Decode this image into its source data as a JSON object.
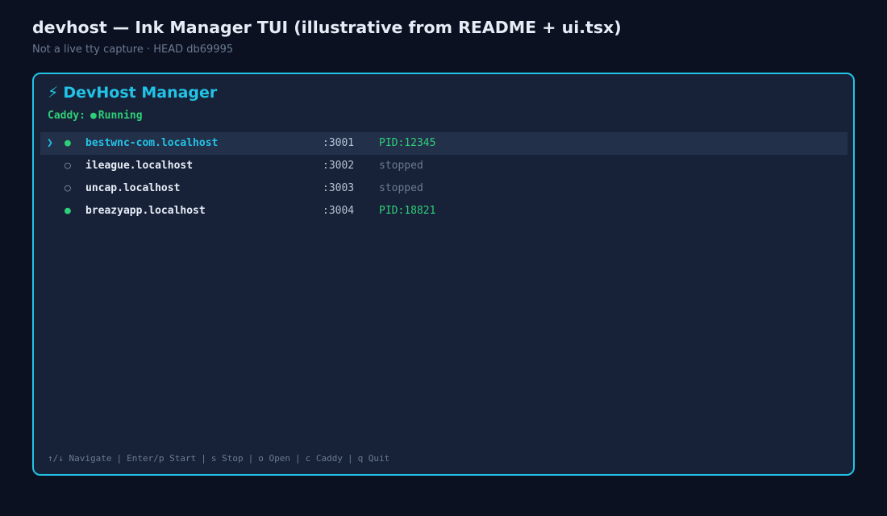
{
  "page": {
    "title": "devhost — Ink Manager TUI (illustrative from README + ui.tsx)",
    "subtitle": "Not a live tty capture · HEAD db69995"
  },
  "app": {
    "bolt_icon": "⚡",
    "title": "DevHost Manager",
    "caddy": {
      "label": "Caddy:",
      "dot": "●",
      "status": "Running"
    }
  },
  "sites": [
    {
      "cursor": "❯",
      "dot": "●",
      "state": "running",
      "host": "bestwnc-com.localhost",
      "port": ":3001",
      "info": "PID:12345",
      "selected": true
    },
    {
      "cursor": "",
      "dot": "○",
      "state": "stopped",
      "host": "ileague.localhost",
      "port": ":3002",
      "info": "stopped",
      "selected": false
    },
    {
      "cursor": "",
      "dot": "○",
      "state": "stopped",
      "host": "uncap.localhost",
      "port": ":3003",
      "info": "stopped",
      "selected": false
    },
    {
      "cursor": "",
      "dot": "●",
      "state": "running",
      "host": "breazyapp.localhost",
      "port": ":3004",
      "info": "PID:18821",
      "selected": false
    }
  ],
  "help": {
    "items": [
      "↑/↓ Navigate",
      "Enter/p Start",
      "s Stop",
      "o Open",
      "c Caddy",
      "q Quit"
    ],
    "separator": "|"
  },
  "colors": {
    "accent": "#22c3e6",
    "running": "#2fce78",
    "stopped": "#8491a8"
  }
}
